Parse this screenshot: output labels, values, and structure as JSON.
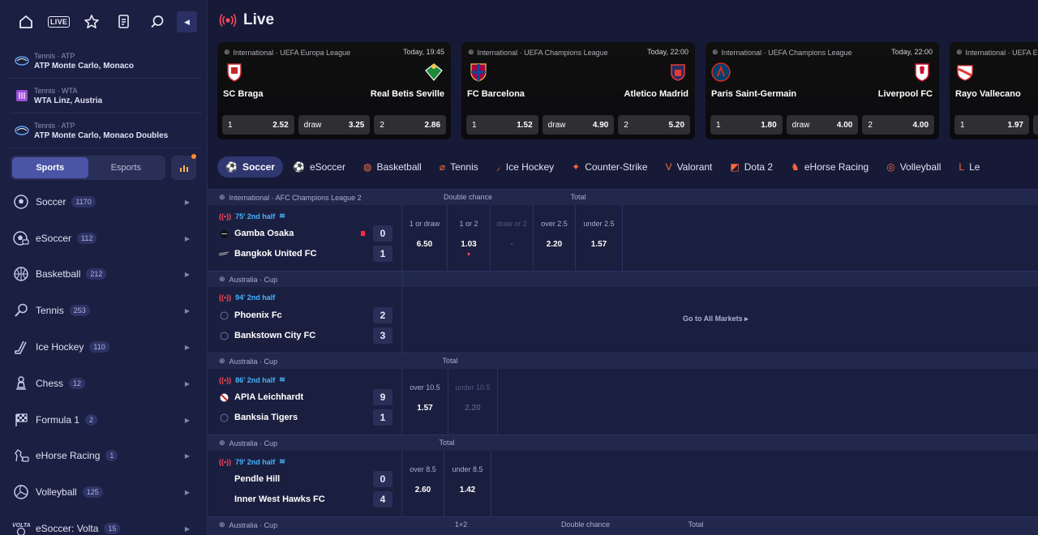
{
  "sidebar": {
    "live_badge": "LIVE",
    "favorites": [
      {
        "category": "Tennis · ATP",
        "name": "ATP Monte Carlo, Monaco"
      },
      {
        "category": "Tennis · WTA",
        "name": "WTA Linz, Austria"
      },
      {
        "category": "Tennis · ATP",
        "name": "ATP Monte Carlo, Monaco Doubles"
      }
    ],
    "toggle": {
      "sports": "Sports",
      "esports": "Esports"
    },
    "sports": [
      {
        "name": "Soccer",
        "count": "1170",
        "icon": "soccer-ball-icon"
      },
      {
        "name": "eSoccer",
        "count": "112",
        "icon": "esoccer-icon"
      },
      {
        "name": "Basketball",
        "count": "212",
        "icon": "basketball-icon"
      },
      {
        "name": "Tennis",
        "count": "253",
        "icon": "tennis-racket-icon"
      },
      {
        "name": "Ice Hockey",
        "count": "110",
        "icon": "hockey-stick-icon"
      },
      {
        "name": "Chess",
        "count": "12",
        "icon": "chess-pawn-icon"
      },
      {
        "name": "Formula 1",
        "count": "2",
        "icon": "checkered-flag-icon"
      },
      {
        "name": "eHorse Racing",
        "count": "1",
        "icon": "horse-icon"
      },
      {
        "name": "Volleyball",
        "count": "125",
        "icon": "volleyball-icon"
      },
      {
        "name": "eSoccer: Volta",
        "count": "15",
        "icon": "volta-icon"
      }
    ]
  },
  "header": {
    "title": "Live"
  },
  "cards": [
    {
      "league": "International · UEFA Europa League",
      "time": "Today, 19:45",
      "home": "SC Braga",
      "away": "Real Betis Seville",
      "odds": [
        {
          "label": "1",
          "value": "2.52"
        },
        {
          "label": "draw",
          "value": "3.25"
        },
        {
          "label": "2",
          "value": "2.86"
        }
      ]
    },
    {
      "league": "International · UEFA Champions League",
      "time": "Today, 22:00",
      "home": "FC Barcelona",
      "away": "Atletico Madrid",
      "odds": [
        {
          "label": "1",
          "value": "1.52"
        },
        {
          "label": "draw",
          "value": "4.90"
        },
        {
          "label": "2",
          "value": "5.20"
        }
      ]
    },
    {
      "league": "International · UEFA Champions League",
      "time": "Today, 22:00",
      "home": "Paris Saint-Germain",
      "away": "Liverpool FC",
      "odds": [
        {
          "label": "1",
          "value": "1.80"
        },
        {
          "label": "draw",
          "value": "4.00"
        },
        {
          "label": "2",
          "value": "4.00"
        }
      ]
    },
    {
      "league": "International · UEFA Europa League",
      "time": "",
      "home": "Rayo Vallecano",
      "away": "",
      "odds": [
        {
          "label": "1",
          "value": "1.97"
        }
      ]
    }
  ],
  "tabs": [
    "Soccer",
    "eSoccer",
    "Basketball",
    "Tennis",
    "Ice Hockey",
    "Counter-Strike",
    "Valorant",
    "Dota 2",
    "eHorse Racing",
    "Volleyball",
    "Le"
  ],
  "matches": [
    {
      "league": "International · AFC Champions League 2",
      "markets": [
        "Double chance",
        "Total"
      ],
      "status": "75' 2nd half",
      "home": "Gamba Osaka",
      "home_score": "0",
      "away": "Bangkok United FC",
      "away_score": "1",
      "odds": [
        {
          "label": "1 or draw",
          "value": "6.50"
        },
        {
          "label": "1 or 2",
          "value": "1.03"
        },
        {
          "label": "draw or 2",
          "value": "-"
        },
        {
          "label": "over 2.5",
          "value": "2.20"
        },
        {
          "label": "under 2.5",
          "value": "1.57"
        }
      ]
    },
    {
      "league": "Australia · Cup",
      "markets": [],
      "status": "94' 2nd half",
      "home": "Phoenix Fc",
      "home_score": "2",
      "away": "Bankstown City FC",
      "away_score": "3",
      "goto": "Go to All Markets ▸"
    },
    {
      "league": "Australia · Cup",
      "markets": [
        "Total"
      ],
      "status": "86' 2nd half",
      "home": "APIA Leichhardt",
      "home_score": "9",
      "away": "Banksia Tigers",
      "away_score": "1",
      "odds": [
        {
          "label": "over 10.5",
          "value": "1.57"
        },
        {
          "label": "under 10.5",
          "value": "2.20"
        }
      ]
    },
    {
      "league": "Australia · Cup",
      "markets": [
        "Total"
      ],
      "status": "79' 2nd half",
      "home": "Pendle Hill",
      "home_score": "0",
      "away": "Inner West Hawks FC",
      "away_score": "4",
      "odds": [
        {
          "label": "over 8.5",
          "value": "2.60"
        },
        {
          "label": "under 8.5",
          "value": "1.42"
        }
      ]
    },
    {
      "league": "Australia · Cup",
      "markets": [
        "1×2",
        "Double chance",
        "Total"
      ]
    }
  ]
}
